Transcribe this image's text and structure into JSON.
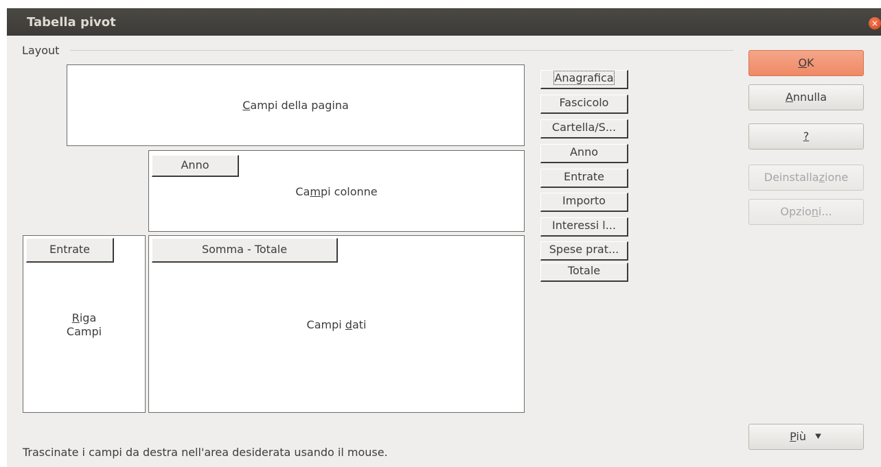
{
  "window": {
    "title": "Tabella pivot",
    "close_icon": "close-icon",
    "close_color": "#e0572b"
  },
  "layout": {
    "label": "Layout",
    "page_fields": {
      "pre": "",
      "mn": "C",
      "post": "ampi della pagina"
    },
    "column_fields": {
      "pre": "Ca",
      "mn": "m",
      "post": "pi colonne",
      "items": [
        "Anno"
      ]
    },
    "row_fields": {
      "line1_mn": "R",
      "line1_post": "iga",
      "line2": "Campi",
      "items": [
        "Entrate"
      ]
    },
    "data_fields": {
      "pre": "Campi ",
      "mn": "d",
      "post": "ati",
      "items": [
        "Somma - Totale"
      ]
    }
  },
  "available_fields": [
    "Anagrafica",
    "Fascicolo",
    "Cartella/S...",
    "Anno",
    "Entrate",
    "Importo",
    "Interessi l...",
    "Spese prat...",
    "Totale"
  ],
  "buttons": {
    "ok": {
      "mn": "O",
      "post": "K"
    },
    "cancel": {
      "mn": "A",
      "post": "nnulla"
    },
    "help": {
      "mn": "?",
      "post": ""
    },
    "uninstall": {
      "pre": "Deinstalla",
      "mn": "z",
      "post": "ione"
    },
    "options": {
      "pre": "Opzio",
      "mn": "n",
      "post": "i..."
    },
    "more": {
      "mn": "P",
      "post": "iù",
      "icon": "double-chevron-down-icon",
      "glyph": "▾"
    }
  },
  "hint_text": "Trascinate i campi da destra nell'area desiderata usando il mouse.",
  "colors": {
    "titlebar": "#3c3b37",
    "dialog_bg": "#efeeec",
    "accent": "#ef8a66"
  }
}
